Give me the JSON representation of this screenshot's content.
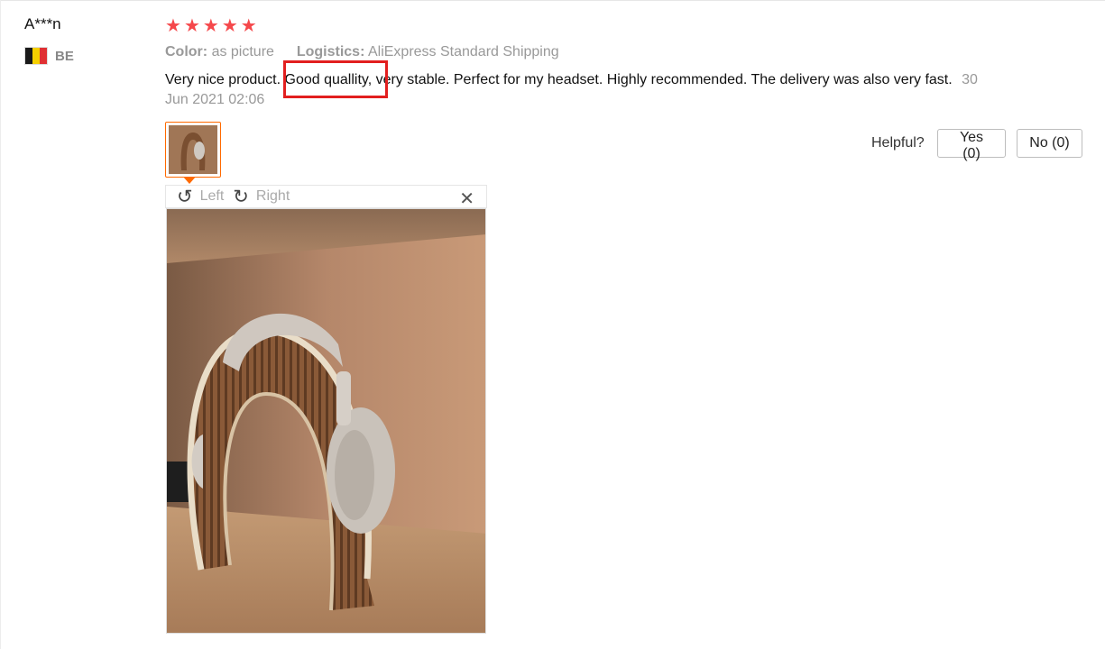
{
  "reviewer": {
    "name": "A***n",
    "country_code": "BE",
    "flag_colors": [
      "#1a1a1a",
      "#f5d000",
      "#e03032"
    ]
  },
  "rating": {
    "stars": 5,
    "star_glyph": "★",
    "color": "#f5484b"
  },
  "attributes": {
    "color_label": "Color:",
    "color_value": "as picture",
    "logistics_label": "Logistics:",
    "logistics_value": "AliExpress Standard Shipping"
  },
  "review": {
    "text": "Very nice product. Good quallity, very stable. Perfect for my headset. Highly recommended. The delivery was also very fast.",
    "date": "30 Jun 2021 02:06"
  },
  "helpful": {
    "label": "Helpful?",
    "yes_label": "Yes (0)",
    "no_label": "No (0)"
  },
  "viewer": {
    "left_label": "Left",
    "right_label": "Right",
    "close_glyph": "✕"
  },
  "colors": {
    "accent": "#ff6a00",
    "highlight": "#e21f1f"
  }
}
